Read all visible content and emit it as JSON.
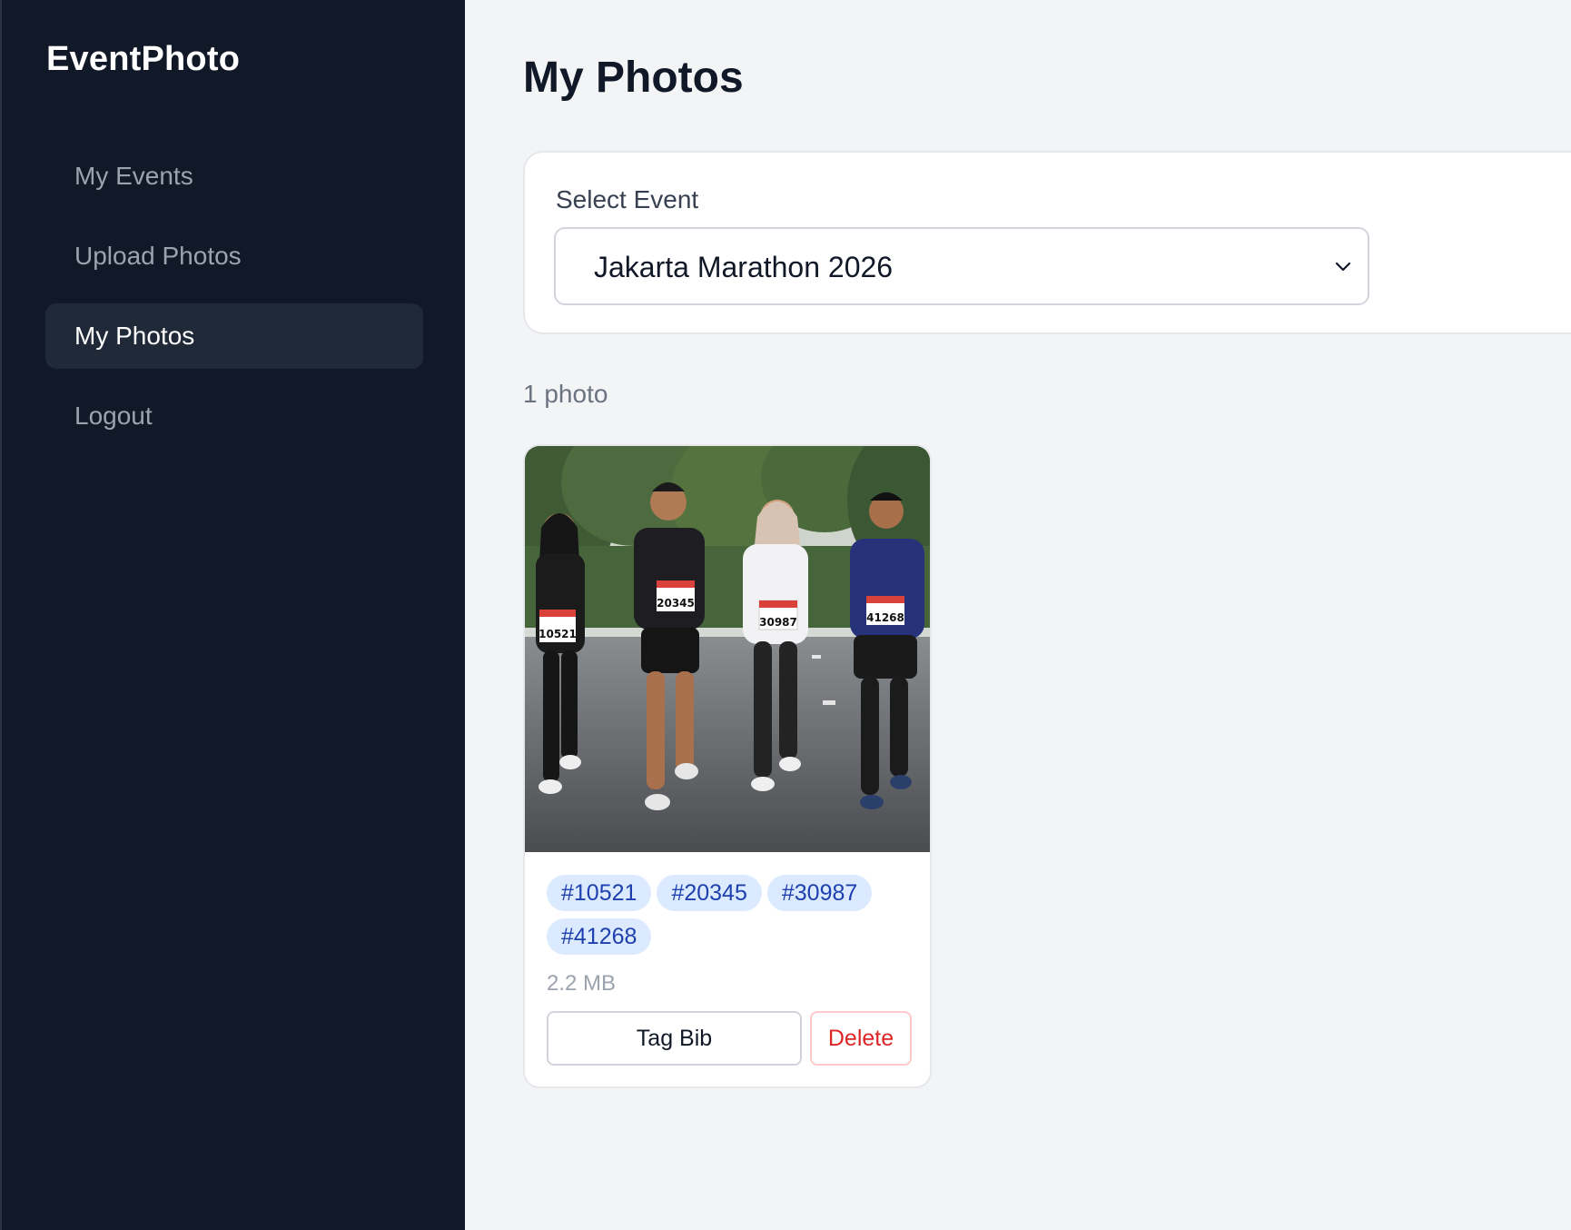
{
  "app": {
    "brand": "EventPhoto"
  },
  "sidebar": {
    "items": [
      {
        "label": "My Events",
        "active": false
      },
      {
        "label": "Upload Photos",
        "active": false
      },
      {
        "label": "My Photos",
        "active": true
      },
      {
        "label": "Logout",
        "active": false
      }
    ]
  },
  "main": {
    "title": "My Photos",
    "event_select": {
      "label": "Select Event",
      "value": "Jakarta Marathon 2026",
      "icon": "chevron-down-icon"
    },
    "photo_count": "1 photo",
    "photos": [
      {
        "tags": [
          "#10521",
          "#20345",
          "#30987",
          "#41268"
        ],
        "bibs": [
          "10521",
          "20345",
          "30987",
          "41268"
        ],
        "size": "2.2 MB",
        "tag_button": "Tag Bib",
        "delete_button": "Delete"
      }
    ]
  },
  "colors": {
    "sidebar_bg": "#111827",
    "nav_active_bg": "#1f2937",
    "page_bg": "#f3f4f6",
    "tag_bg": "#dbeafe",
    "tag_text": "#1e40af",
    "danger": "#dc2626"
  }
}
